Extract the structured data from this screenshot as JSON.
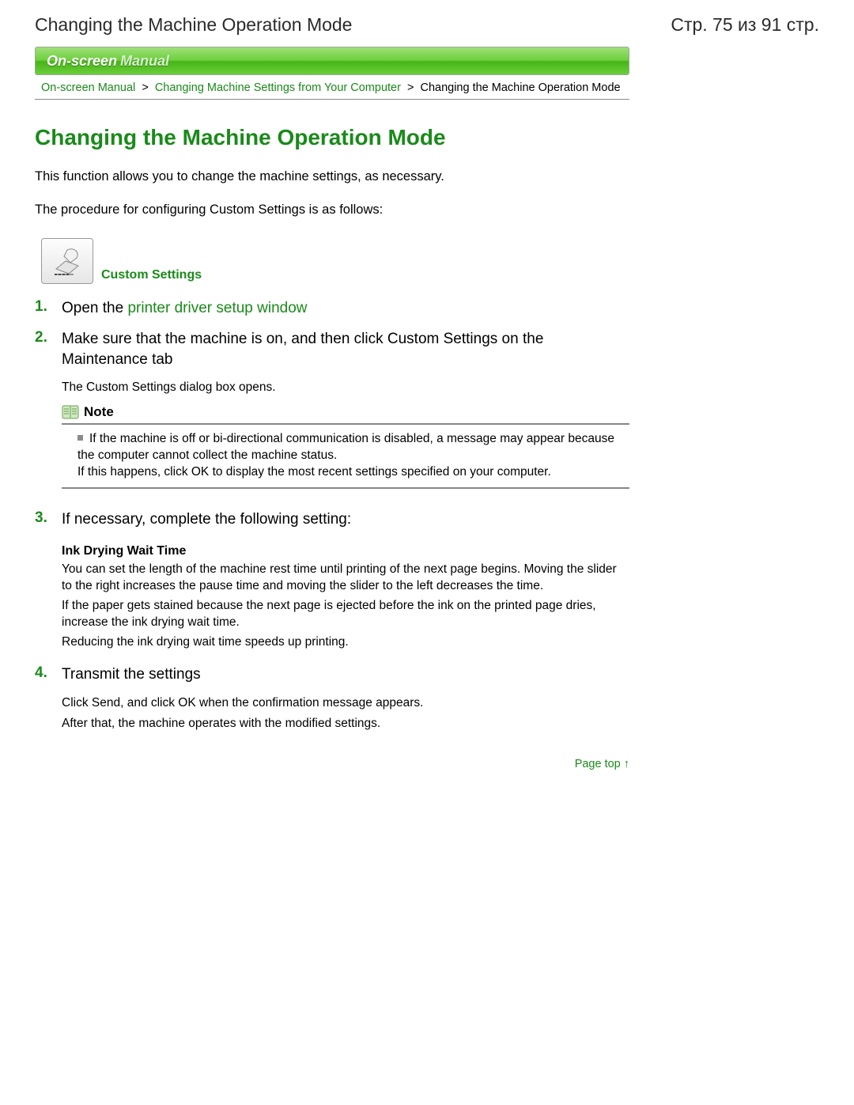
{
  "header": {
    "left": "Changing the Machine Operation Mode",
    "right": "Стр. 75 из 91 стр."
  },
  "banner": {
    "main": "On-screen",
    "sub": "Manual"
  },
  "breadcrumbs": {
    "a": "On-screen Manual",
    "b": "Changing Machine Settings from Your Computer",
    "c": "Changing the Machine Operation Mode"
  },
  "title": "Changing the Machine Operation Mode",
  "intro1": "This function allows you to change the machine settings, as necessary.",
  "intro2": "The procedure for configuring Custom Settings is as follows:",
  "custom_settings_label": "Custom Settings",
  "steps": {
    "s1": {
      "num": "1.",
      "prefix": "Open the ",
      "link": "printer driver setup window"
    },
    "s2": {
      "num": "2.",
      "title": "Make sure that the machine is on, and then click Custom Settings on the Maintenance tab",
      "desc": "The Custom Settings dialog box opens."
    },
    "note": {
      "label": "Note",
      "line1": "If the machine is off or bi-directional communication is disabled, a message may appear because the computer cannot collect the machine status.",
      "line2": "If this happens, click OK to display the most recent settings specified on your computer."
    },
    "s3": {
      "num": "3.",
      "title": "If necessary, complete the following setting:",
      "sub_h": "Ink Drying Wait Time",
      "sub_p1": "You can set the length of the machine rest time until printing of the next page begins. Moving the slider to the right increases the pause time and moving the slider to the left decreases the time.",
      "sub_p2": "If the paper gets stained because the next page is ejected before the ink on the printed page dries, increase the ink drying wait time.",
      "sub_p3": "Reducing the ink drying wait time speeds up printing."
    },
    "s4": {
      "num": "4.",
      "title": "Transmit the settings",
      "desc1": "Click Send, and click OK when the confirmation message appears.",
      "desc2": "After that, the machine operates with the modified settings."
    }
  },
  "page_top": "Page top"
}
